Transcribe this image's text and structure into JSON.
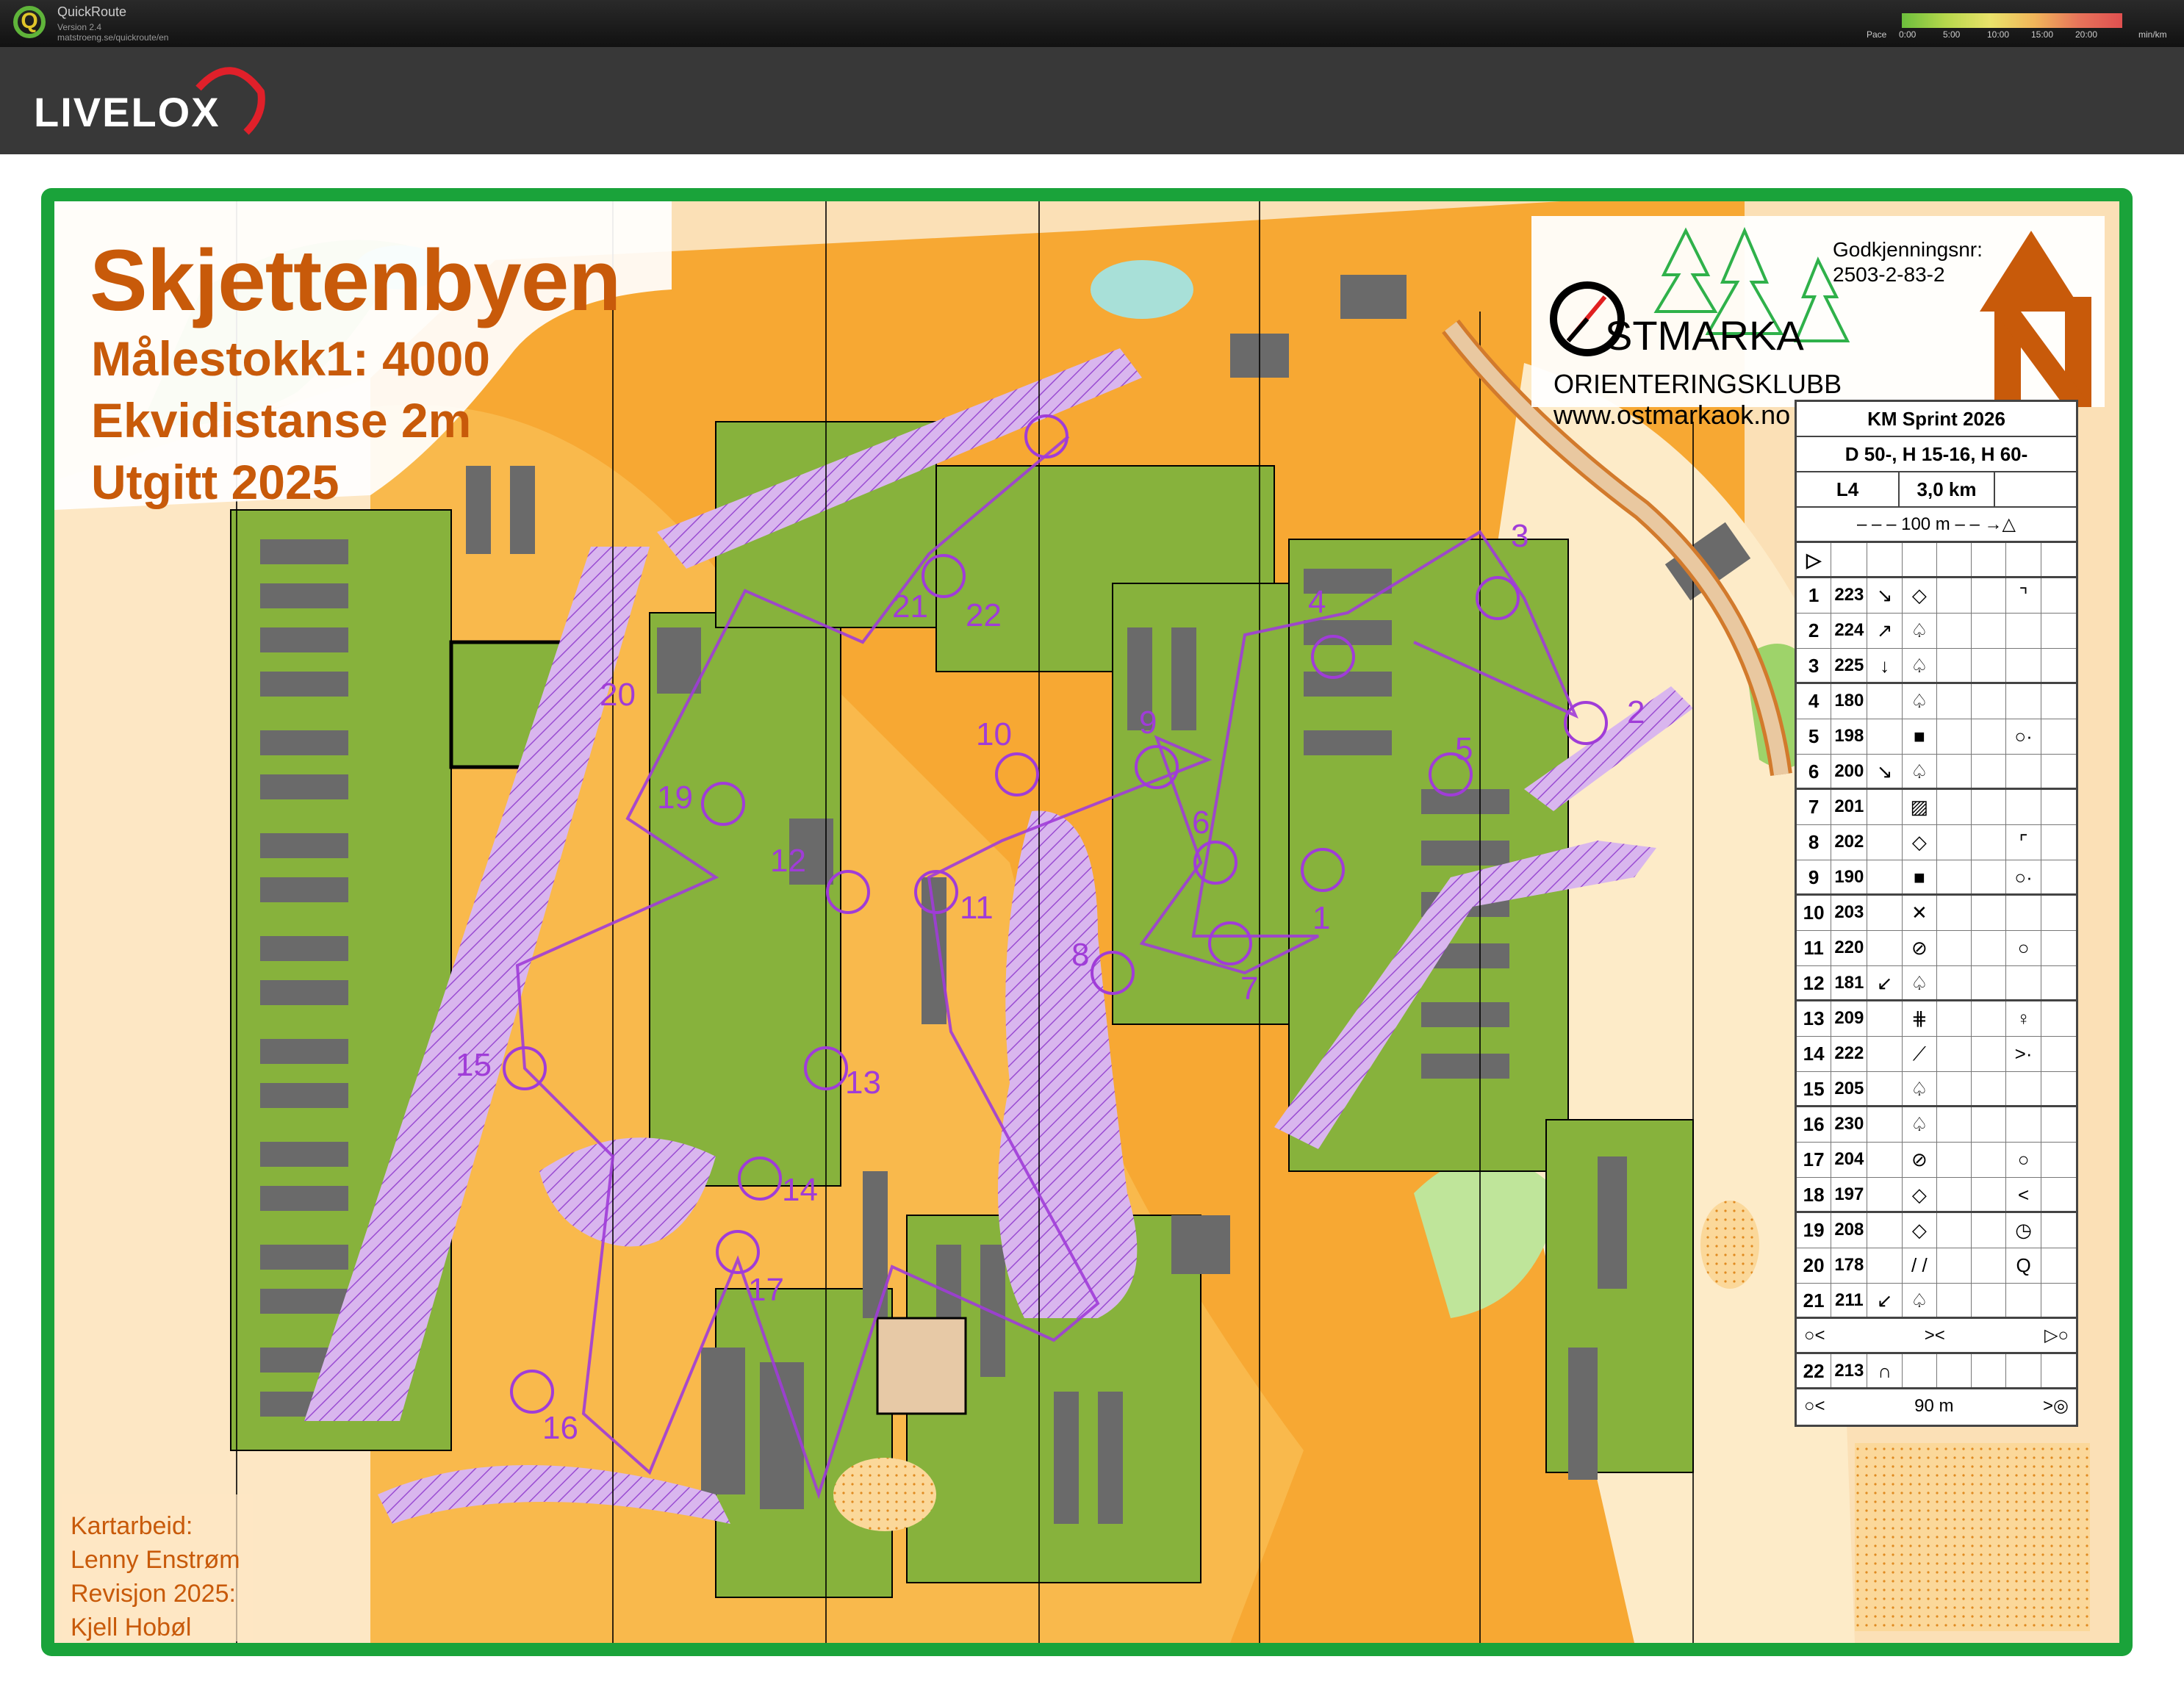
{
  "quickroute": {
    "title": "QuickRoute",
    "version": "Version 2.4",
    "url": "matstroeng.se/quickroute/en",
    "pace_label": "Pace",
    "pace_ticks": [
      "0:00",
      "5:00",
      "10:00",
      "15:00",
      "20:00"
    ],
    "pace_unit": "min/km"
  },
  "livelox": {
    "logo_text": "LIVELOX"
  },
  "map": {
    "title": "Skjettenbyen",
    "scale": "Målestokk1: 4000",
    "contour": "Ekvidistanse 2m",
    "published": "Utgitt 2025",
    "credits": [
      "Kartarbeid:",
      "Lenny Enstrøm",
      "Revisjon 2025:",
      "Kjell Hobøl"
    ],
    "club": {
      "name": "STMARKA",
      "full_name": "ORIENTERINGSKLUBB",
      "website": "www.ostmarkaok.no"
    },
    "approval_label": "Godkjenningsnr:",
    "approval_number": "2503-2-83-2",
    "north_arrow": "north-arrow-icon",
    "colors": {
      "frame": "#1aa33a",
      "course": "#a03cd8",
      "text_brown": "#c85a0a",
      "open_land": "#f7a833",
      "green": "#87b23c",
      "building": "#6a6a6a"
    },
    "controls": [
      "1",
      "2",
      "3",
      "4",
      "5",
      "6",
      "7",
      "8",
      "9",
      "10",
      "11",
      "12",
      "13",
      "14",
      "15",
      "16",
      "17",
      "19",
      "20",
      "21",
      "22"
    ]
  },
  "control_description": {
    "event": "KM Sprint 2026",
    "classes": "D 50-, H 15-16, H 60-",
    "course": "L4",
    "length": "3,0 km",
    "legend_distance": "100 m",
    "rows": [
      {
        "num": "1",
        "code": "223",
        "dir": "↘",
        "feature": "◇",
        "extra": "⌝"
      },
      {
        "num": "2",
        "code": "224",
        "dir": "↗",
        "feature": "♤",
        "extra": ""
      },
      {
        "num": "3",
        "code": "225",
        "dir": "↓",
        "feature": "♤",
        "extra": ""
      },
      {
        "num": "4",
        "code": "180",
        "dir": "",
        "feature": "♤",
        "extra": ""
      },
      {
        "num": "5",
        "code": "198",
        "dir": "",
        "feature": "■",
        "extra": "○·"
      },
      {
        "num": "6",
        "code": "200",
        "dir": "↘",
        "feature": "♤",
        "extra": ""
      },
      {
        "num": "7",
        "code": "201",
        "dir": "",
        "feature": "▨",
        "extra": ""
      },
      {
        "num": "8",
        "code": "202",
        "dir": "",
        "feature": "◇",
        "extra": "⌜"
      },
      {
        "num": "9",
        "code": "190",
        "dir": "",
        "feature": "■",
        "extra": "○·"
      },
      {
        "num": "10",
        "code": "203",
        "dir": "",
        "feature": "✕",
        "extra": ""
      },
      {
        "num": "11",
        "code": "220",
        "dir": "",
        "feature": "⊘",
        "extra": "○"
      },
      {
        "num": "12",
        "code": "181",
        "dir": "↙",
        "feature": "♤",
        "extra": ""
      },
      {
        "num": "13",
        "code": "209",
        "dir": "",
        "feature": "⋕",
        "extra": "♀"
      },
      {
        "num": "14",
        "code": "222",
        "dir": "",
        "feature": "⟋",
        "extra": ">·"
      },
      {
        "num": "15",
        "code": "205",
        "dir": "",
        "feature": "♤",
        "extra": ""
      },
      {
        "num": "16",
        "code": "230",
        "dir": "",
        "feature": "♤",
        "extra": ""
      },
      {
        "num": "17",
        "code": "204",
        "dir": "",
        "feature": "⊘",
        "extra": "○"
      },
      {
        "num": "18",
        "code": "197",
        "dir": "",
        "feature": "◇",
        "extra": "<"
      },
      {
        "num": "19",
        "code": "208",
        "dir": "",
        "feature": "◇",
        "extra": "◷"
      },
      {
        "num": "20",
        "code": "178",
        "dir": "",
        "feature": "/ /",
        "extra": "Q"
      },
      {
        "num": "21",
        "code": "211",
        "dir": "↙",
        "feature": "♤",
        "extra": ""
      }
    ],
    "row22": {
      "num": "22",
      "code": "213",
      "feature": "∩"
    },
    "finish_distance": "90 m"
  }
}
